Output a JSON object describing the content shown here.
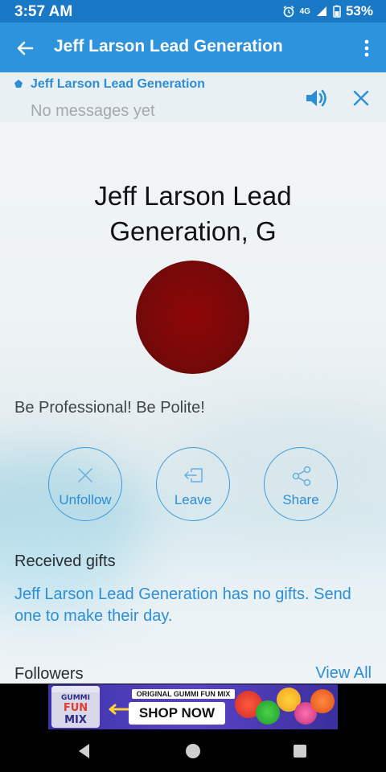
{
  "status_bar": {
    "time": "3:57 AM",
    "network": "4G",
    "battery": "53%"
  },
  "app_bar": {
    "title": "Jeff Larson Lead Generation",
    "back_icon": "arrow-back-icon",
    "menu_icon": "more-vert-icon"
  },
  "chat_banner": {
    "name": "Jeff Larson Lead Generation",
    "subtitle": "No messages yet"
  },
  "profile": {
    "title": "Jeff Larson Lead Generation, G",
    "avatar_color": "#7f0808",
    "tagline": "Be Professional! Be Polite!"
  },
  "actions": [
    {
      "label": "Unfollow",
      "icon": "close-icon"
    },
    {
      "label": "Leave",
      "icon": "exit-icon"
    },
    {
      "label": "Share",
      "icon": "share-icon"
    }
  ],
  "gifts": {
    "heading": "Received gifts",
    "empty_text": "Jeff Larson Lead Generation has no gifts. Send one to make their day."
  },
  "followers": {
    "heading": "Followers",
    "view_all": "View All"
  },
  "ad": {
    "bag_line1": "GUMMI",
    "bag_line2": "FUN",
    "bag_line3": "MIX",
    "title": "ORIGINAL GUMMI FUN MIX",
    "cta": "SHOP NOW"
  },
  "colors": {
    "accent": "#2d93dd",
    "status_bar": "#1a79c7",
    "link": "#2d8ed6"
  }
}
